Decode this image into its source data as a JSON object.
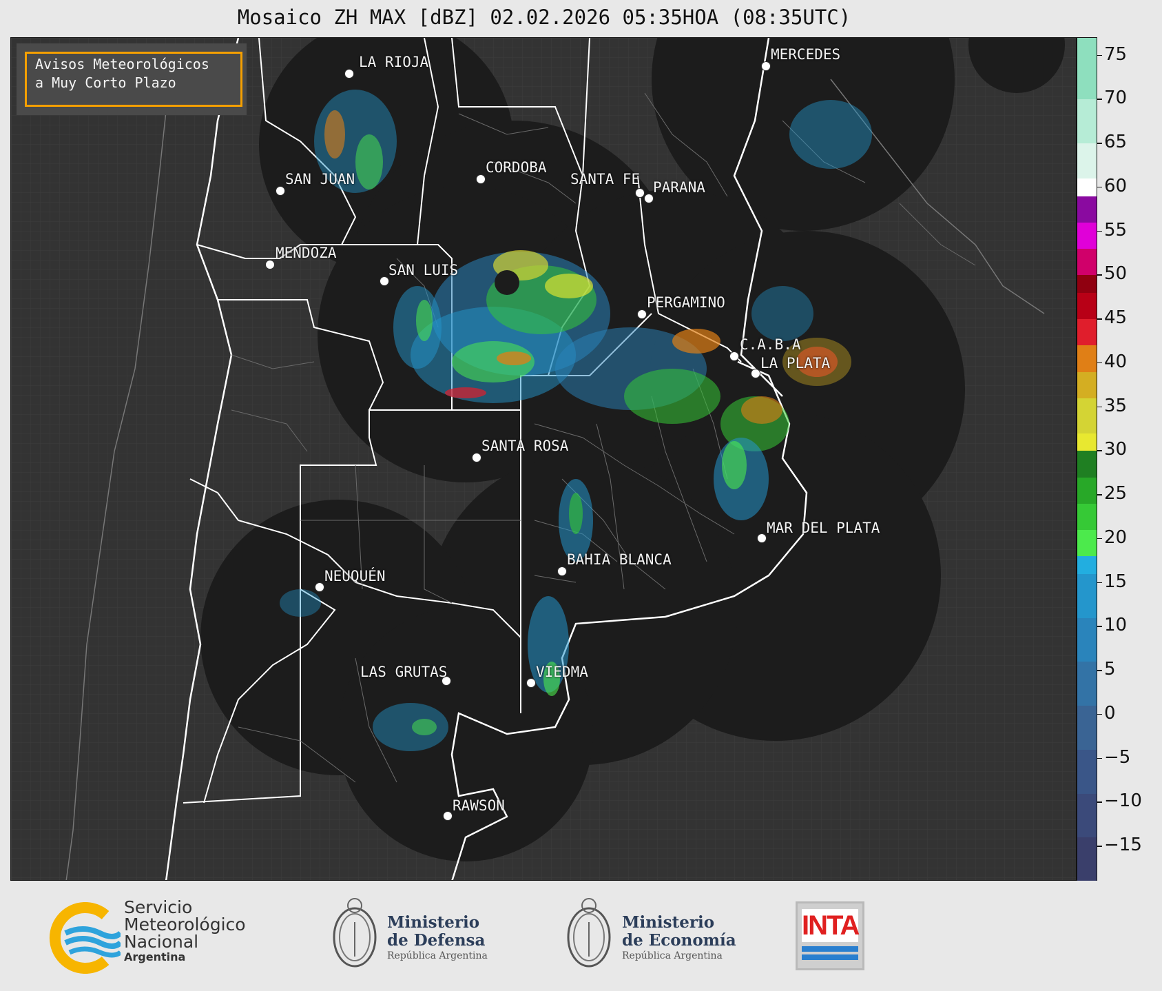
{
  "title": "Mosaico ZH MAX [dBZ] 02.02.2026 05:35HOA (08:35UTC)",
  "notice": {
    "line1": "Avisos Meteorológicos",
    "line2": "a Muy Corto Plazo"
  },
  "cities": [
    {
      "name": "LA RIOJA"
    },
    {
      "name": "MERCEDES"
    },
    {
      "name": "CORDOBA"
    },
    {
      "name": "SAN JUAN"
    },
    {
      "name": "SANTA FE"
    },
    {
      "name": "PARANA"
    },
    {
      "name": "MENDOZA"
    },
    {
      "name": "SAN LUIS"
    },
    {
      "name": "PERGAMINO"
    },
    {
      "name": "C.A.B.A"
    },
    {
      "name": "LA PLATA"
    },
    {
      "name": "SANTA ROSA"
    },
    {
      "name": "MAR DEL PLATA"
    },
    {
      "name": "BAHIA BLANCA"
    },
    {
      "name": "NEUQUÉN"
    },
    {
      "name": "LAS GRUTAS"
    },
    {
      "name": "VIEDMA"
    },
    {
      "name": "RAWSON"
    }
  ],
  "colorbar": {
    "unit": "dBZ",
    "min": -19,
    "max": 77,
    "ticks": [
      "75",
      "70",
      "65",
      "60",
      "55",
      "50",
      "45",
      "40",
      "35",
      "30",
      "25",
      "20",
      "15",
      "10",
      "5",
      "0",
      "−5",
      "−10",
      "−15"
    ],
    "tick_values": [
      75,
      70,
      65,
      60,
      55,
      50,
      45,
      40,
      35,
      30,
      25,
      20,
      15,
      10,
      5,
      0,
      -5,
      -10,
      -15
    ],
    "colors": [
      {
        "from": -19,
        "to": -14,
        "color": "#3a3f6b"
      },
      {
        "from": -14,
        "to": -9,
        "color": "#3b4a7a"
      },
      {
        "from": -9,
        "to": -4,
        "color": "#3a5688"
      },
      {
        "from": -4,
        "to": 1,
        "color": "#3a6494"
      },
      {
        "from": 1,
        "to": 6,
        "color": "#3373a6"
      },
      {
        "from": 6,
        "to": 11,
        "color": "#2a84bb"
      },
      {
        "from": 11,
        "to": 16,
        "color": "#2496cc"
      },
      {
        "from": 16,
        "to": 18,
        "color": "#22aee0"
      },
      {
        "from": 18,
        "to": 21,
        "color": "#4cea4c"
      },
      {
        "from": 21,
        "to": 24,
        "color": "#36c936"
      },
      {
        "from": 24,
        "to": 27,
        "color": "#28a828"
      },
      {
        "from": 27,
        "to": 30,
        "color": "#1f7f22"
      },
      {
        "from": 30,
        "to": 32,
        "color": "#e8e830"
      },
      {
        "from": 32,
        "to": 36,
        "color": "#d4d434"
      },
      {
        "from": 36,
        "to": 39,
        "color": "#d4ae22"
      },
      {
        "from": 39,
        "to": 42,
        "color": "#e07f16"
      },
      {
        "from": 42,
        "to": 45,
        "color": "#e01e2c"
      },
      {
        "from": 45,
        "to": 48,
        "color": "#b80016"
      },
      {
        "from": 48,
        "to": 50,
        "color": "#900010"
      },
      {
        "from": 50,
        "to": 53,
        "color": "#d0006a"
      },
      {
        "from": 53,
        "to": 56,
        "color": "#e000d8"
      },
      {
        "from": 56,
        "to": 59,
        "color": "#8a0aa0"
      },
      {
        "from": 59,
        "to": 61,
        "color": "#ffffff"
      },
      {
        "from": 61,
        "to": 65,
        "color": "#dcf4ea"
      },
      {
        "from": 65,
        "to": 70,
        "color": "#b6ecd6"
      },
      {
        "from": 70,
        "to": 77,
        "color": "#8edfbe"
      }
    ]
  },
  "logos": {
    "smn": {
      "line1": "Servicio",
      "line2": "Meteorológico",
      "line3": "Nacional",
      "line4": "Argentina"
    },
    "defensa": {
      "line1": "Ministerio",
      "line2": "de Defensa",
      "line3": "República Argentina"
    },
    "economia": {
      "line1": "Ministerio",
      "line2": "de Economía",
      "line3": "República Argentina"
    },
    "inta": {
      "text": "INTA"
    }
  }
}
